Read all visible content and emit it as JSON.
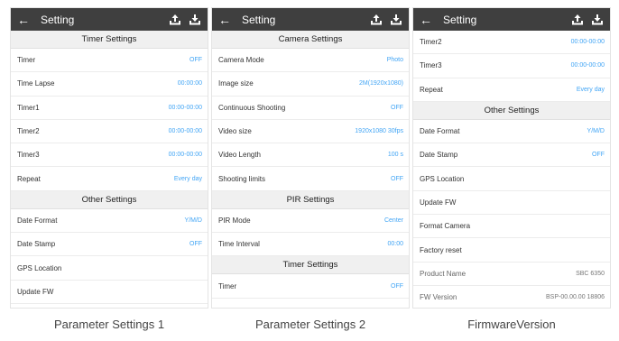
{
  "screens": [
    {
      "title": "Setting",
      "caption": "Parameter Settings 1",
      "sections": [
        {
          "header": "Timer Settings",
          "rows": [
            {
              "label": "Timer",
              "value": "OFF"
            },
            {
              "label": "Time Lapse",
              "value": "00:00:00"
            },
            {
              "label": "Timer1",
              "value": "00:00-00:00"
            },
            {
              "label": "Timer2",
              "value": "00:00-00:00"
            },
            {
              "label": "Timer3",
              "value": "00:00-00:00"
            },
            {
              "label": "Repeat",
              "value": "Every day"
            }
          ]
        },
        {
          "header": "Other Settings",
          "rows": [
            {
              "label": "Date Format",
              "value": "Y/M/D"
            },
            {
              "label": "Date Stamp",
              "value": "OFF"
            },
            {
              "label": "GPS Location",
              "value": ""
            },
            {
              "label": "Update FW",
              "value": ""
            }
          ]
        }
      ]
    },
    {
      "title": "Setting",
      "caption": "Parameter Settings 2",
      "sections": [
        {
          "header": "Camera Settings",
          "rows": [
            {
              "label": "Camera Mode",
              "value": "Photo"
            },
            {
              "label": "Image size",
              "value": "2M(1920x1080)"
            },
            {
              "label": "Continuous Shooting",
              "value": "OFF"
            },
            {
              "label": "Video size",
              "value": "1920x1080 30fps"
            },
            {
              "label": "Video Length",
              "value": "100 s"
            },
            {
              "label": "Shooting limits",
              "value": "OFF"
            }
          ]
        },
        {
          "header": "PIR Settings",
          "rows": [
            {
              "label": "PIR Mode",
              "value": "Center"
            },
            {
              "label": "Time Interval",
              "value": "00:00"
            }
          ]
        },
        {
          "header": "Timer Settings",
          "rows": [
            {
              "label": "Timer",
              "value": "OFF"
            }
          ]
        }
      ]
    },
    {
      "title": "Setting",
      "caption": "FirmwareVersion",
      "sections": [
        {
          "header": "",
          "rows": [
            {
              "label": "Timer2",
              "value": "00:00-00:00"
            },
            {
              "label": "Timer3",
              "value": "00:00-00:00"
            },
            {
              "label": "Repeat",
              "value": "Every day"
            }
          ]
        },
        {
          "header": "Other Settings",
          "rows": [
            {
              "label": "Date Format",
              "value": "Y/M/D"
            },
            {
              "label": "Date Stamp",
              "value": "OFF"
            },
            {
              "label": "GPS Location",
              "value": ""
            },
            {
              "label": "Update FW",
              "value": ""
            },
            {
              "label": "Format Camera",
              "value": ""
            },
            {
              "label": "Factory reset",
              "value": ""
            },
            {
              "label": "Product Name",
              "value": "SBC 6350",
              "muted": true
            },
            {
              "label": "FW Version",
              "value": "BSP-00.00.00 18806",
              "muted": true
            }
          ]
        }
      ]
    }
  ],
  "icons": {
    "back": "back-arrow-icon",
    "action_1": "upload-tray-icon",
    "action_2": "download-tray-icon"
  },
  "colors": {
    "appbar": "#3f3f3f",
    "value": "#42a5f5",
    "section_header": "#f0f0f0"
  }
}
